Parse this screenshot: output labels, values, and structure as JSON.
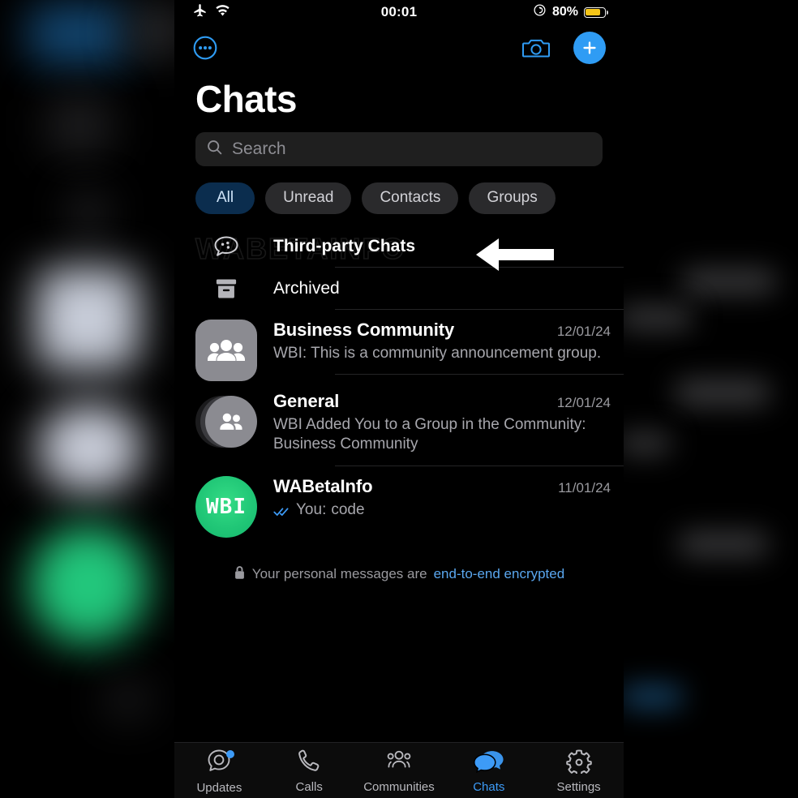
{
  "status_bar": {
    "airplane_icon": "airplane-mode-icon",
    "wifi_icon": "wifi-icon",
    "time": "00:01",
    "rotation_lock_icon": "rotation-lock-icon",
    "battery_percent": "80%",
    "battery_level": 80,
    "battery_color": "#f5c518"
  },
  "nav": {
    "menu_icon": "more-options-icon",
    "camera_icon": "camera-icon",
    "new_chat_icon": "plus-icon",
    "accent": "#2f9cf4"
  },
  "header": {
    "title": "Chats"
  },
  "search": {
    "placeholder": "Search",
    "icon": "search-icon"
  },
  "filters": [
    {
      "label": "All",
      "selected": true
    },
    {
      "label": "Unread",
      "selected": false
    },
    {
      "label": "Contacts",
      "selected": false
    },
    {
      "label": "Groups",
      "selected": false
    }
  ],
  "watermark": "WABETAINFO",
  "annotation": {
    "arrow": "left-arrow-annotation",
    "color": "#ffffff"
  },
  "rows": {
    "third_party": {
      "label": "Third-party Chats",
      "icon": "third-party-chat-bubble-icon"
    },
    "archived": {
      "label": "Archived",
      "icon": "archive-box-icon"
    }
  },
  "chats": [
    {
      "name": "Business Community",
      "preview": "WBI: This is a community announcement group.",
      "date": "12/01/24",
      "avatar": "community-group-avatar",
      "avatar_type": "square",
      "avatar_color": "#8b8b91",
      "read_receipt": false
    },
    {
      "name": "General",
      "preview": "WBI Added You to a Group in the Community: Business Community",
      "date": "12/01/24",
      "avatar": "group-in-community-avatar",
      "avatar_type": "stack",
      "avatar_color": "#8b8b91",
      "read_receipt": false
    },
    {
      "name": "WABetaInfo",
      "preview_prefix": "You:",
      "preview": "code",
      "date": "11/01/24",
      "avatar": "wbi-avatar",
      "avatar_type": "circle",
      "avatar_initials": "WBI",
      "avatar_color": "#21c777",
      "read_receipt": true,
      "read_receipt_color": "#3d9bf7"
    }
  ],
  "encryption_notice": {
    "icon": "lock-icon",
    "text": "Your personal messages are",
    "link": "end-to-end encrypted"
  },
  "tabs": [
    {
      "label": "Updates",
      "icon": "updates-icon",
      "active": false,
      "badge": true
    },
    {
      "label": "Calls",
      "icon": "phone-icon",
      "active": false,
      "badge": false
    },
    {
      "label": "Communities",
      "icon": "communities-icon",
      "active": false,
      "badge": false
    },
    {
      "label": "Chats",
      "icon": "chats-icon",
      "active": true,
      "badge": false
    },
    {
      "label": "Settings",
      "icon": "gear-icon",
      "active": false,
      "badge": false
    }
  ]
}
